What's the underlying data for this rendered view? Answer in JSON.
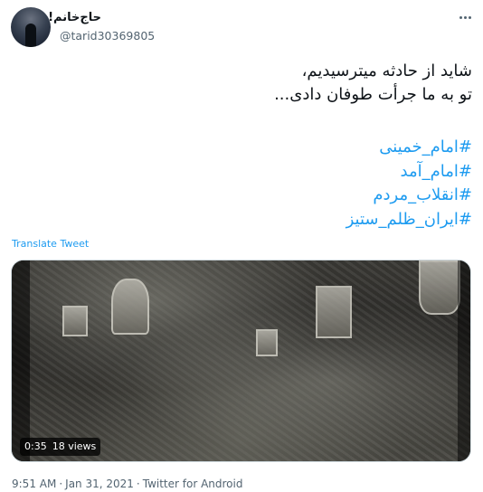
{
  "author": {
    "display_name": "حاج‌خانم!",
    "handle": "@tarid30369805"
  },
  "tweet": {
    "lines": [
      "شاید از حادثه میترسیدیم،",
      "تو به ما جرأت طوفان دادی..."
    ],
    "hashtags": [
      "#امام_خمینی",
      "#امام_آمد",
      "#انقلاب_مردم",
      "#ایران_ظلم_ستیز"
    ],
    "translate_label": "Translate Tweet"
  },
  "media": {
    "duration": "0:35",
    "views": "18 views"
  },
  "meta": {
    "time": "9:51 AM",
    "date": "Jan 31, 2021",
    "separator": "·",
    "source": "Twitter for Android"
  },
  "icons": {
    "more": "more-horizontal-icon"
  },
  "colors": {
    "link": "#1d9bf0",
    "secondary_text": "#536471",
    "text": "#0f1419"
  }
}
